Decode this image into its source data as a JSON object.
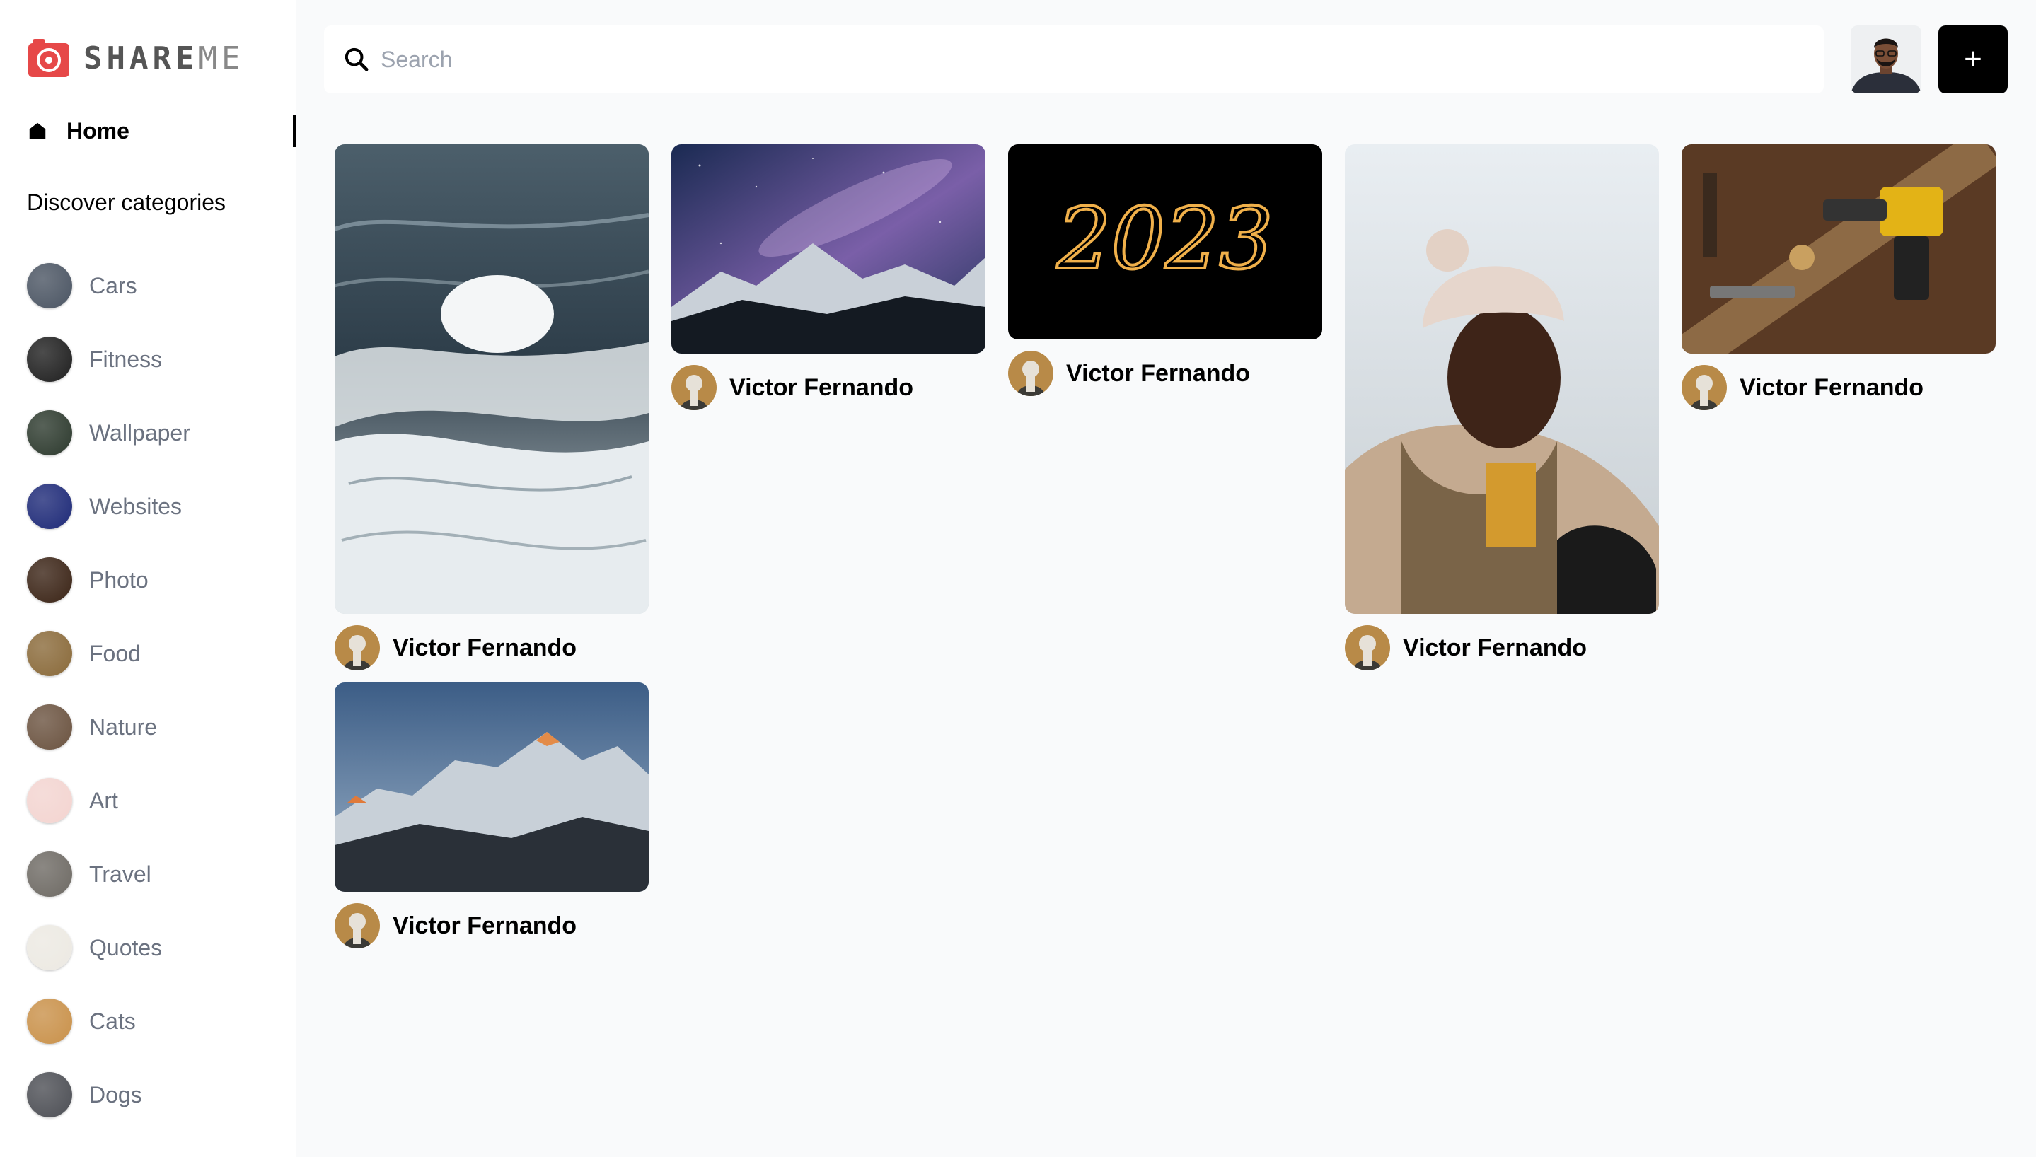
{
  "app": {
    "logo_text_main": "SHARE",
    "logo_text_accent": "ME"
  },
  "sidebar": {
    "home_label": "Home",
    "discover_heading": "Discover categories",
    "categories": [
      {
        "label": "Cars",
        "icon": "cars-thumbnail",
        "color": "#4b5563"
      },
      {
        "label": "Fitness",
        "icon": "fitness-thumbnail",
        "color": "#1f1f1f"
      },
      {
        "label": "Wallpaper",
        "icon": "wallpaper-thumbnail",
        "color": "#2d3a2e"
      },
      {
        "label": "Websites",
        "icon": "websites-thumbnail",
        "color": "#1e2a78"
      },
      {
        "label": "Photo",
        "icon": "photo-thumbnail",
        "color": "#3b2416"
      },
      {
        "label": "Food",
        "icon": "food-thumbnail",
        "color": "#8a6a3a"
      },
      {
        "label": "Nature",
        "icon": "nature-thumbnail",
        "color": "#6b5340"
      },
      {
        "label": "Art",
        "icon": "art-thumbnail",
        "color": "#f3d4d0"
      },
      {
        "label": "Travel",
        "icon": "travel-thumbnail",
        "color": "#6e6a64"
      },
      {
        "label": "Quotes",
        "icon": "quotes-thumbnail",
        "color": "#ece9e2"
      },
      {
        "label": "Cats",
        "icon": "cats-thumbnail",
        "color": "#c9914a"
      },
      {
        "label": "Dogs",
        "icon": "dogs-thumbnail",
        "color": "#4d4f55"
      }
    ]
  },
  "header": {
    "search_placeholder": "Search",
    "add_label": "+"
  },
  "pins": [
    {
      "image": "ocean-waves",
      "user": "Victor Fernando"
    },
    {
      "image": "milky-way-mountains",
      "user": "Victor Fernando"
    },
    {
      "image": "sparkler-2023",
      "user": "Victor Fernando",
      "image_text": "2023"
    },
    {
      "image": "woman-in-beanie",
      "user": "Victor Fernando"
    },
    {
      "image": "tools-drill",
      "user": "Victor Fernando"
    },
    {
      "image": "everest-sunset",
      "user": "Victor Fernando"
    }
  ]
}
